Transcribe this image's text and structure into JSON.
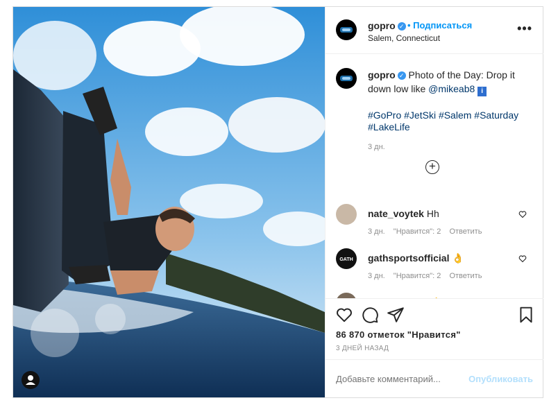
{
  "post": {
    "username": "gopro",
    "verified_glyph": "✓",
    "follow_label": "• Подписаться",
    "location": "Salem, Connecticut",
    "more_glyph": "•••"
  },
  "caption": {
    "username": "gopro",
    "text": "Photo of the Day: Drop it down low like",
    "mention": "@mikeab8",
    "info_glyph": "i",
    "hashtags": "#GoPro #JetSki #Salem #Saturday #LakeLife",
    "time": "3 дн."
  },
  "comments": [
    {
      "username": "nate_voytek",
      "text": "Hh",
      "time": "3 дн.",
      "likes": "\"Нравится\": 2",
      "reply": "Ответить",
      "avatar_color": "#c9b8a6"
    },
    {
      "username": "gathsportsofficial",
      "text": "👌",
      "time": "3 дн.",
      "likes": "\"Нравится\": 2",
      "reply": "Ответить",
      "avatar_color": "#111111"
    },
    {
      "username": "ozgur_cocuk",
      "text": "👌",
      "avatar_color": "#7a6a5a"
    }
  ],
  "actions": {
    "likes": "86 870 отметок \"Нравится\"",
    "ago": "3 ДНЕЙ НАЗАД",
    "icons": [
      "heart-icon",
      "comment-icon",
      "share-icon",
      "bookmark-icon"
    ]
  },
  "composer": {
    "placeholder": "Добавьте комментарий...",
    "publish_label": "Опубликовать"
  },
  "colors": {
    "link": "#00376b",
    "accent": "#0095f6",
    "publish_disabled": "#b2dffc",
    "muted": "#8e8e8e"
  }
}
